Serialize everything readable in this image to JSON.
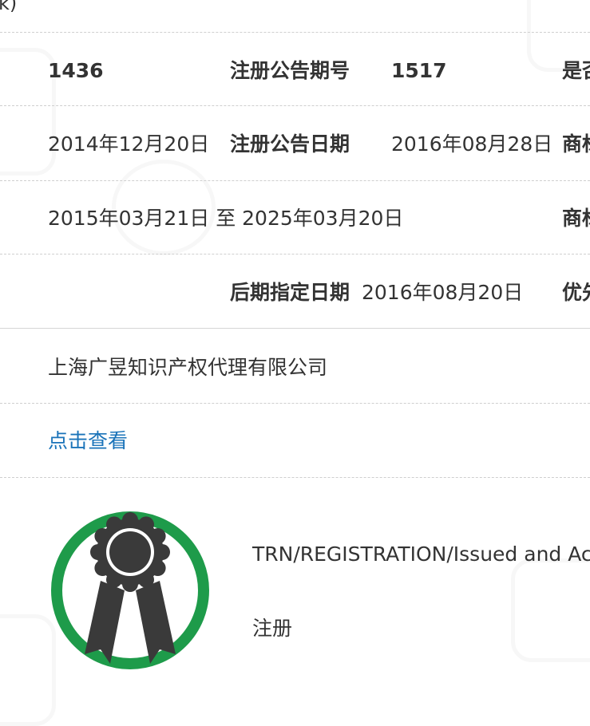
{
  "top_fragment": "k)",
  "rows": [
    {
      "c1": "1436",
      "c2": "注册公告期号",
      "c3": "1517",
      "c4": "是否"
    },
    {
      "c1": "2014年12月20日",
      "c2": "注册公告日期",
      "c3": "2016年08月28日",
      "c4": "商标"
    },
    {
      "c1": "2015年03月21日 至 2025年03月20日",
      "c4": "商标"
    },
    {
      "c2": "后期指定日期",
      "c3": "2016年08月20日",
      "c4": "优先"
    }
  ],
  "agent": "上海广昱知识产权代理有限公司",
  "view_link": "点击查看",
  "status": {
    "code": "TRN/REGISTRATION/Issued and Act",
    "label": "注册",
    "badge_ring_color": "#1e9b4a",
    "badge_color": "#3a3a3a",
    "badge_icon": "award-ribbon-icon"
  }
}
